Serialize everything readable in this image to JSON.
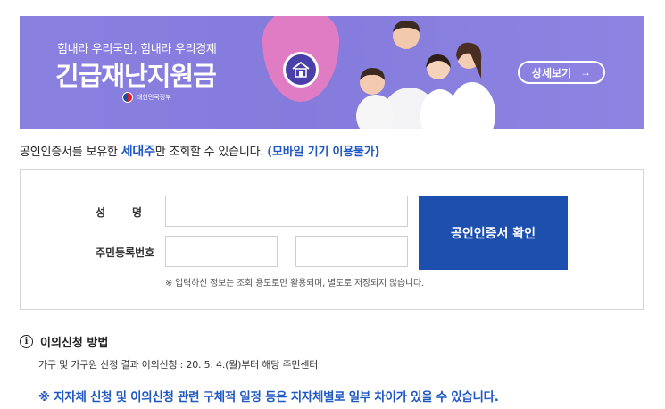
{
  "banner": {
    "subtitle": "힘내라 우리국민, 힘내라 우리경제",
    "title": "긴급재난지원금",
    "gov_label": "대한민국정부",
    "detail_button": "상세보기",
    "detail_arrow": "→",
    "colors": {
      "background": "#8a80e0",
      "drop": "#f07cc0",
      "circle": "#4a3fa8"
    }
  },
  "notice": {
    "prefix": "공인인증서를 보유한 ",
    "highlight": "세대주",
    "middle": "만 조회할 수 있습니다. ",
    "mobile_note": "(모바일 기기 이용불가)"
  },
  "form": {
    "name_label": "성명",
    "rrn_label": "주민등록번호",
    "name_value": "",
    "rrn_front_value": "",
    "rrn_back_value": "",
    "cert_button": "공인인증서 확인",
    "hint": "※ 입력하신 정보는 조회 용도로만 활용되며, 별도로 저장되지 않습니다."
  },
  "objection": {
    "icon": "info-icon",
    "title": "이의신청 방법",
    "description": "가구 및 가구원 산정 결과 이의신청 : 20. 5. 4.(월)부터 해당 주민센터",
    "warning": "※ 지자체 신청 및 이의신청 관련 구체적 일정 등은 지자체별로 일부 차이가 있을 수 있습니다."
  },
  "colors": {
    "accent_blue": "#1f57c3",
    "button_blue": "#1d4fae"
  }
}
